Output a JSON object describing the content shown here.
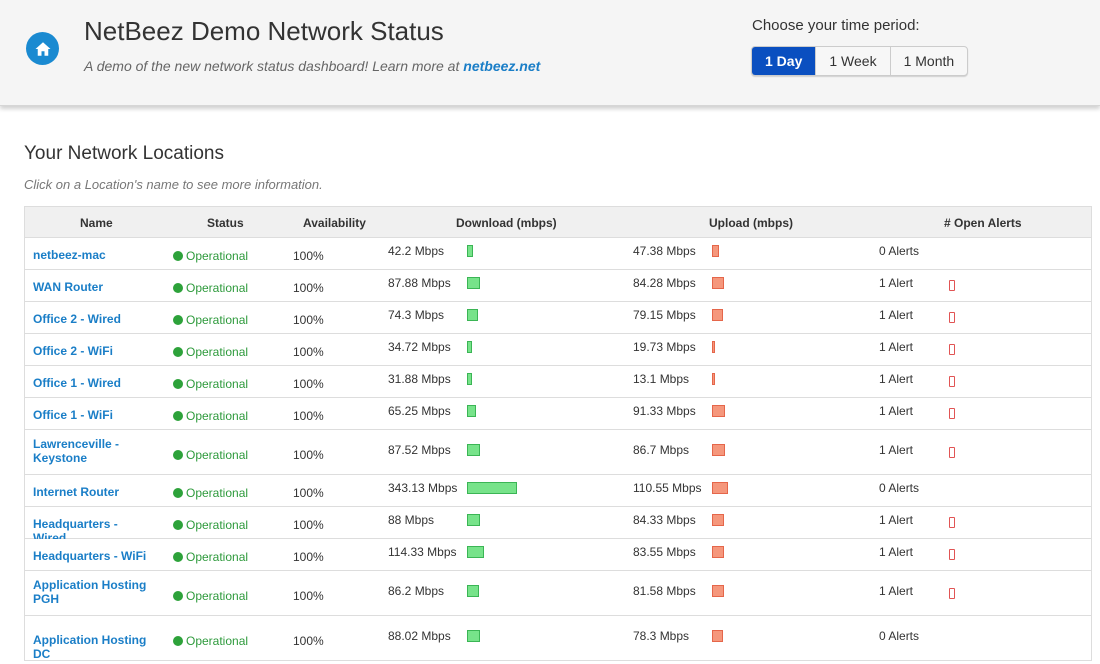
{
  "header": {
    "title": "NetBeez Demo Network Status",
    "subtitle_prefix": "A demo of the new network status dashboard! Learn more at",
    "subtitle_link": "netbeez.net",
    "period_label": "Choose your time period:",
    "periods": [
      "1 Day",
      "1 Week",
      "1 Month"
    ],
    "active_period": "1 Day",
    "icon": "home-icon",
    "accent_color": "#1a8ad1"
  },
  "section": {
    "title": "Your Network Locations",
    "hint": "Click on a Location's name to see more information."
  },
  "table": {
    "columns": [
      "Name",
      "Status",
      "Availability",
      "Download (mbps)",
      "Upload (mbps)",
      "# Open Alerts"
    ],
    "rows": [
      {
        "name": "netbeez-mac",
        "status": "Operational",
        "availability": "100%",
        "download": "42.2 Mbps",
        "upload": "47.38 Mbps",
        "alerts": "0 Alerts"
      },
      {
        "name": "WAN Router",
        "status": "Operational",
        "availability": "100%",
        "download": "87.88 Mbps",
        "upload": "84.28 Mbps",
        "alerts": "1 Alert"
      },
      {
        "name": "Office 2 - Wired",
        "status": "Operational",
        "availability": "100%",
        "download": "74.3 Mbps",
        "upload": "79.15 Mbps",
        "alerts": "1 Alert"
      },
      {
        "name": "Office 2 - WiFi",
        "status": "Operational",
        "availability": "100%",
        "download": "34.72 Mbps",
        "upload": "19.73 Mbps",
        "alerts": "1 Alert"
      },
      {
        "name": "Office 1 - Wired",
        "status": "Operational",
        "availability": "100%",
        "download": "31.88 Mbps",
        "upload": "13.1 Mbps",
        "alerts": "1 Alert"
      },
      {
        "name": "Office 1 - WiFi",
        "status": "Operational",
        "availability": "100%",
        "download": "65.25 Mbps",
        "upload": "91.33 Mbps",
        "alerts": "1 Alert"
      },
      {
        "name": "Lawrenceville - Keystone",
        "status": "Operational",
        "availability": "100%",
        "download": "87.52 Mbps",
        "upload": "86.7 Mbps",
        "alerts": "1 Alert"
      },
      {
        "name": "Internet Router",
        "status": "Operational",
        "availability": "100%",
        "download": "343.13 Mbps",
        "upload": "110.55 Mbps",
        "alerts": "0 Alerts"
      },
      {
        "name": "Headquarters - Wired",
        "status": "Operational",
        "availability": "100%",
        "download": "88 Mbps",
        "upload": "84.33 Mbps",
        "alerts": "1 Alert"
      },
      {
        "name": "Headquarters - WiFi",
        "status": "Operational",
        "availability": "100%",
        "download": "114.33 Mbps",
        "upload": "83.55 Mbps",
        "alerts": "1 Alert"
      },
      {
        "name": "Application Hosting PGH",
        "status": "Operational",
        "availability": "100%",
        "download": "86.2 Mbps",
        "upload": "81.58 Mbps",
        "alerts": "1 Alert"
      },
      {
        "name": "Application Hosting DC",
        "status": "Operational",
        "availability": "100%",
        "download": "88.02 Mbps",
        "upload": "78.3 Mbps",
        "alerts": "0 Alerts"
      }
    ]
  }
}
